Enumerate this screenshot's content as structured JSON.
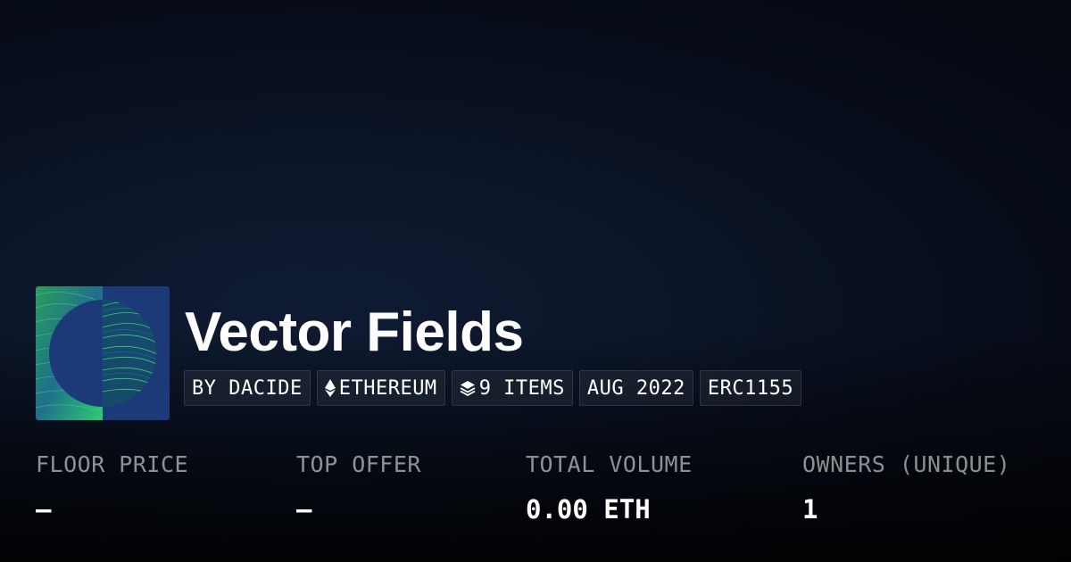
{
  "collection": {
    "title": "Vector Fields",
    "creator": "BY DACIDE",
    "chain": "ETHEREUM",
    "item_count": "9 ITEMS",
    "date": "AUG 2022",
    "standard": "ERC1155",
    "icons": {
      "chain": "ethereum-icon",
      "items": "layers-icon"
    }
  },
  "stats": {
    "floor_price": {
      "label": "FLOOR PRICE",
      "value": "–"
    },
    "top_offer": {
      "label": "TOP OFFER",
      "value": "–"
    },
    "total_volume": {
      "label": "TOTAL VOLUME",
      "value": "0.00 ETH"
    },
    "owners": {
      "label": "OWNERS (UNIQUE)",
      "value": "1"
    }
  },
  "colors": {
    "background": "#0b1528",
    "thumbnail_bg": "#1d3a78",
    "thumbnail_accent": "#2ecc71",
    "text_muted": "#8c8f96"
  }
}
